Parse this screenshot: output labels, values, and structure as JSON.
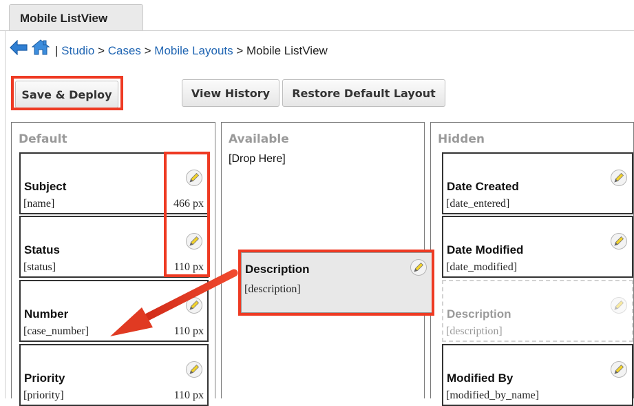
{
  "tab": {
    "label": "Mobile ListView"
  },
  "breadcrumb": {
    "separator": " | ",
    "arrow": " > ",
    "items": [
      "Studio",
      "Cases",
      "Mobile Layouts"
    ],
    "current": "Mobile ListView"
  },
  "toolbar": {
    "save_label": "Save & Deploy",
    "history_label": "View History",
    "restore_label": "Restore Default Layout"
  },
  "columns": {
    "default": {
      "title": "Default",
      "fields": [
        {
          "label": "Subject",
          "key": "[name]",
          "width": "466 px"
        },
        {
          "label": "Status",
          "key": "[status]",
          "width": "110 px"
        },
        {
          "label": "Number",
          "key": "[case_number]",
          "width": "110 px"
        },
        {
          "label": "Priority",
          "key": "[priority]",
          "width": "110 px"
        }
      ]
    },
    "available": {
      "title": "Available",
      "drop_text": "[Drop Here]",
      "dragging_field": {
        "label": "Description",
        "key": "[description]"
      }
    },
    "hidden": {
      "title": "Hidden",
      "fields": [
        {
          "label": "Date Created",
          "key": "[date_entered]"
        },
        {
          "label": "Date Modified",
          "key": "[date_modified]"
        },
        {
          "label": "Description",
          "key": "[description]"
        },
        {
          "label": "Modified By",
          "key": "[modified_by_name]"
        }
      ]
    }
  },
  "colors": {
    "annotation": "#ee3a23",
    "link": "#2166b3",
    "column_title": "#9a9a9a"
  },
  "icons": [
    "back-arrow-icon",
    "home-icon",
    "pencil-edit-icon"
  ]
}
